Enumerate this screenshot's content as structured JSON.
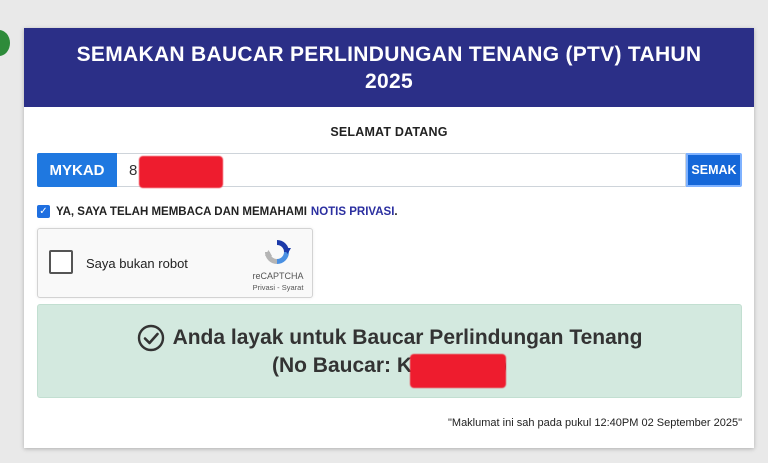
{
  "header": {
    "title": "SEMAKAN BAUCAR PERLINDUNGAN TENANG (PTV) TAHUN 2025"
  },
  "welcome": "SELAMAT DATANG",
  "form": {
    "mykad_label": "MYKAD",
    "mykad_value": "8",
    "submit_label": "SEMAK"
  },
  "consent": {
    "text": "YA, SAYA TELAH MEMBACA DAN MEMAHAMI",
    "link": "NOTIS PRIVASI",
    "suffix": "."
  },
  "recaptcha": {
    "label": "Saya bukan robot",
    "brand": "reCAPTCHA",
    "terms": "Privasi - Syarat"
  },
  "result": {
    "line1": "Anda layak untuk Baucar Perlindungan Tenang",
    "line2_prefix": "(No Baucar: K",
    "line2_suffix": ")"
  },
  "footer": {
    "note": "\"Maklumat ini sah pada pukul 12:40PM 02 September 2025\""
  },
  "colors": {
    "header_bg": "#2b2f87",
    "button_blue": "#1f78e0",
    "success_bg": "#d3e9df",
    "redaction": "#ee1c2e"
  }
}
